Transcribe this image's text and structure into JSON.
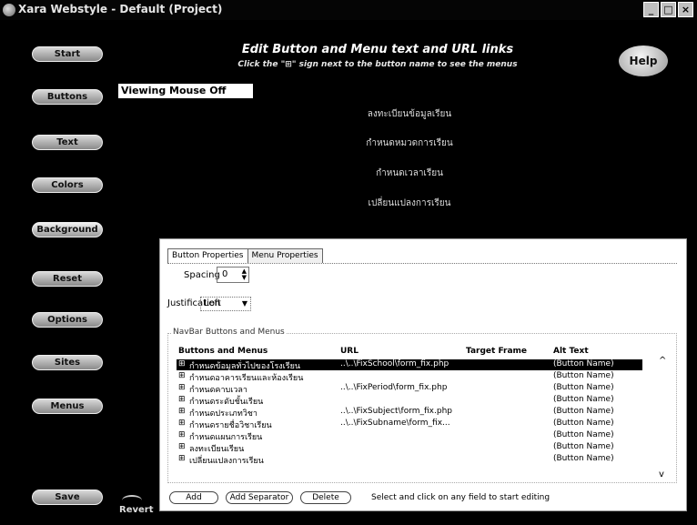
{
  "window": {
    "title": "Xara Webstyle - Default (Project)",
    "controls": [
      "_",
      "□",
      "×"
    ]
  },
  "sidebar": {
    "items": [
      {
        "label": "Start"
      },
      {
        "label": "Buttons"
      },
      {
        "label": "Text"
      },
      {
        "label": "Colors"
      },
      {
        "label": "Background"
      },
      {
        "label": "Reset"
      },
      {
        "label": "Options"
      },
      {
        "label": "Sites"
      },
      {
        "label": "Menus"
      },
      {
        "label": "Save"
      }
    ],
    "revert_label": "Revert"
  },
  "header": {
    "title": "Edit Button and Menu text and URL links",
    "subtitle": "Click the \"⊞\" sign next to the button name to see the menus",
    "help_label": "Help"
  },
  "preview": {
    "state_label": "Viewing Mouse Off State",
    "items": [
      "ลงทะเบียนข้อมูลเรียน",
      "กำหนดหมวดการเรียน",
      "กำหนดเวลาเรียน",
      "เปลี่ยนแปลงการเรียน"
    ]
  },
  "panel": {
    "tabs": [
      "Button Properties",
      "Menu Properties"
    ],
    "spacing_label": "Spacing",
    "spacing_value": "0",
    "justification_label": "Justification",
    "justification_value": "Left",
    "group_title": "NavBar Buttons and Menus",
    "columns": [
      "Buttons and Menus",
      "URL",
      "Target Frame",
      "Alt Text"
    ],
    "rows": [
      {
        "name": "กำหนดข้อมูลทั่วไปของโรงเรียน",
        "url": "..\\..\\FixSchool\\form_fix.php",
        "target": "",
        "alt": "(Button Name)",
        "selected": true
      },
      {
        "name": "กำหนดอาคารเรียนและห้องเรียน",
        "url": "",
        "target": "",
        "alt": "(Button Name)",
        "selected": false
      },
      {
        "name": "กำหนดคาบเวลา",
        "url": "..\\..\\FixPeriod\\form_fix.php",
        "target": "",
        "alt": "(Button Name)",
        "selected": false
      },
      {
        "name": "กำหนดระดับชั้นเรียน",
        "url": "",
        "target": "",
        "alt": "(Button Name)",
        "selected": false
      },
      {
        "name": "กำหนดประเภทวิชา",
        "url": "..\\..\\FixSubject\\form_fix.php",
        "target": "",
        "alt": "(Button Name)",
        "selected": false
      },
      {
        "name": "กำหนดรายชื่อวิชาเรียน",
        "url": "..\\..\\FixSubname\\form_fix...",
        "target": "",
        "alt": "(Button Name)",
        "selected": false
      },
      {
        "name": "กำหนดแผนการเรียน",
        "url": "",
        "target": "",
        "alt": "(Button Name)",
        "selected": false
      },
      {
        "name": "ลงทะเบียนเรียน",
        "url": "",
        "target": "",
        "alt": "(Button Name)",
        "selected": false
      },
      {
        "name": "เปลี่ยนแปลงการเรียน",
        "url": "",
        "target": "",
        "alt": "(Button Name)",
        "selected": false
      }
    ],
    "buttons": {
      "add": "Add",
      "add_separator": "Add Separator",
      "delete": "Delete"
    },
    "hint": "Select and click on any field to start editing"
  }
}
